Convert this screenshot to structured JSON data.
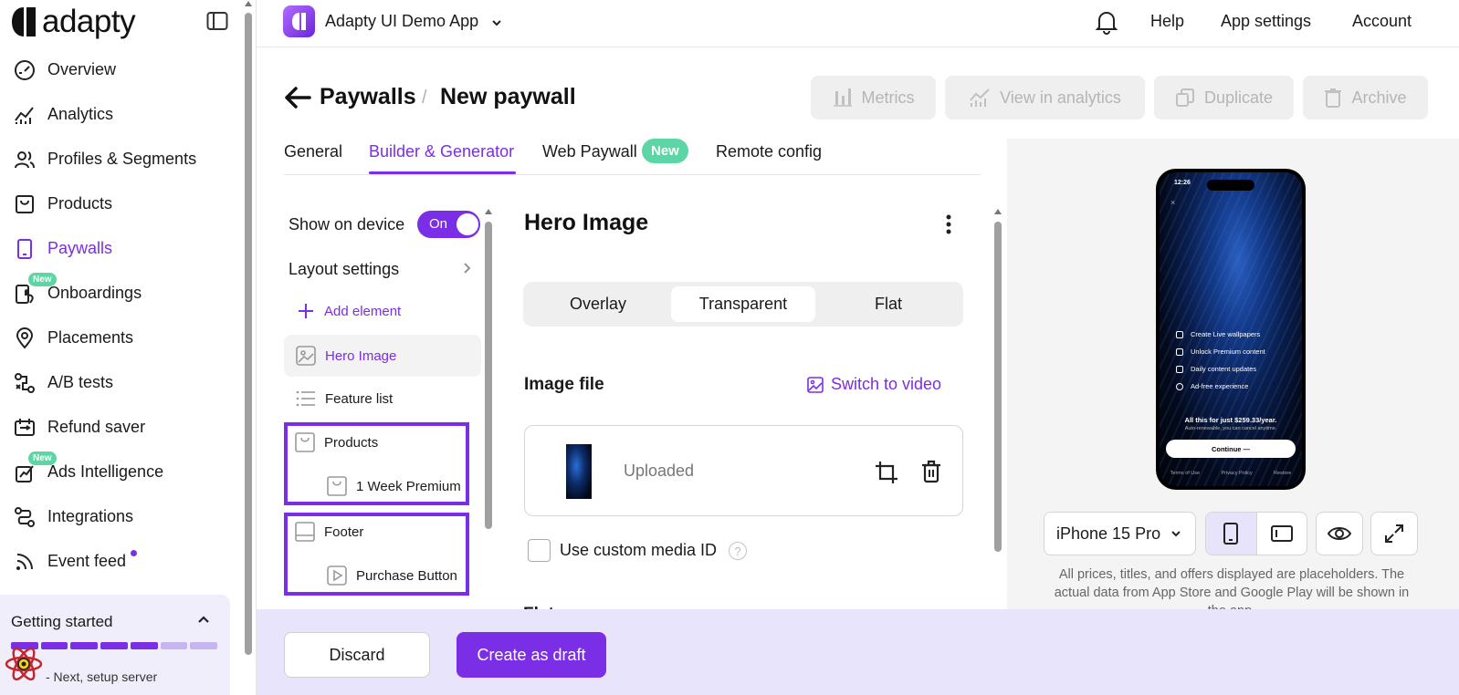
{
  "sidebar": {
    "logo_text": "adapty",
    "nav": [
      {
        "label": "Overview",
        "icon": "gauge-icon"
      },
      {
        "label": "Analytics",
        "icon": "chart-line-icon"
      },
      {
        "label": "Profiles & Segments",
        "icon": "users-icon"
      },
      {
        "label": "Products",
        "icon": "box-icon"
      },
      {
        "label": "Paywalls",
        "icon": "phone-icon",
        "active": true
      },
      {
        "label": "Onboardings",
        "icon": "onboarding-icon",
        "badge": "New"
      },
      {
        "label": "Placements",
        "icon": "map-pin-icon"
      },
      {
        "label": "A/B tests",
        "icon": "ab-test-icon"
      },
      {
        "label": "Refund saver",
        "icon": "refund-icon"
      },
      {
        "label": "Ads Intelligence",
        "icon": "ads-chart-icon",
        "badge": "New"
      },
      {
        "label": "Integrations",
        "icon": "integrations-icon"
      },
      {
        "label": "Event feed",
        "icon": "rss-icon",
        "notification_dot": true
      }
    ],
    "getting_started": {
      "title": "Getting started",
      "progress_steps_done": 5,
      "progress_steps_total": 7,
      "next_text": "- Next, setup server"
    }
  },
  "topbar": {
    "app_name": "Adapty UI Demo App",
    "help": "Help",
    "app_settings": "App settings",
    "account": "Account"
  },
  "page": {
    "breadcrumb_parent": "Paywalls",
    "breadcrumb_separator": "/",
    "title": "New paywall",
    "actions": {
      "metrics": "Metrics",
      "view_in_analytics": "View in analytics",
      "duplicate": "Duplicate",
      "archive": "Archive"
    },
    "tabs": {
      "general": "General",
      "builder": "Builder & Generator",
      "web_paywall": "Web Paywall",
      "web_paywall_badge": "New",
      "remote_config": "Remote config"
    }
  },
  "tree": {
    "show_on_device": "Show on device",
    "toggle_label": "On",
    "layout_settings": "Layout settings",
    "add_element": "Add element",
    "items": {
      "hero_image": "Hero Image",
      "feature_list": "Feature list",
      "products": "Products",
      "product_child": "1 Week Premium",
      "footer": "Footer",
      "footer_child": "Purchase Button"
    }
  },
  "props": {
    "title": "Hero Image",
    "modes": [
      "Overlay",
      "Transparent",
      "Flat"
    ],
    "active_mode": "Transparent",
    "image_file_label": "Image file",
    "switch_to_video": "Switch to video",
    "upload_status": "Uploaded",
    "custom_media_label": "Use custom media ID",
    "help_glyph": "?",
    "peek_section": "Flat"
  },
  "preview": {
    "time": "12:26",
    "close": "×",
    "features": [
      "Create Live wallpapers",
      "Unlock Premium content",
      "Daily content updates",
      "Ad-free experience"
    ],
    "price_line": "All this for just $259.33/year.",
    "sub_line": "Auto-renewable, you can cancel anytime.",
    "cta": "Continue —",
    "footer_links": [
      "Terms of Use",
      "Privacy Policy",
      "Restore"
    ],
    "device": "iPhone 15 Pro",
    "disclaimer": "All prices, titles, and offers displayed are placeholders. The actual data from App Store and Google Play will be shown in the app."
  },
  "footer_bar": {
    "discard": "Discard",
    "create_draft": "Create as draft"
  },
  "colors": {
    "accent": "#7a2ee6",
    "new_badge": "#5cd6a4",
    "bottom_bar": "#e8e4fb"
  }
}
